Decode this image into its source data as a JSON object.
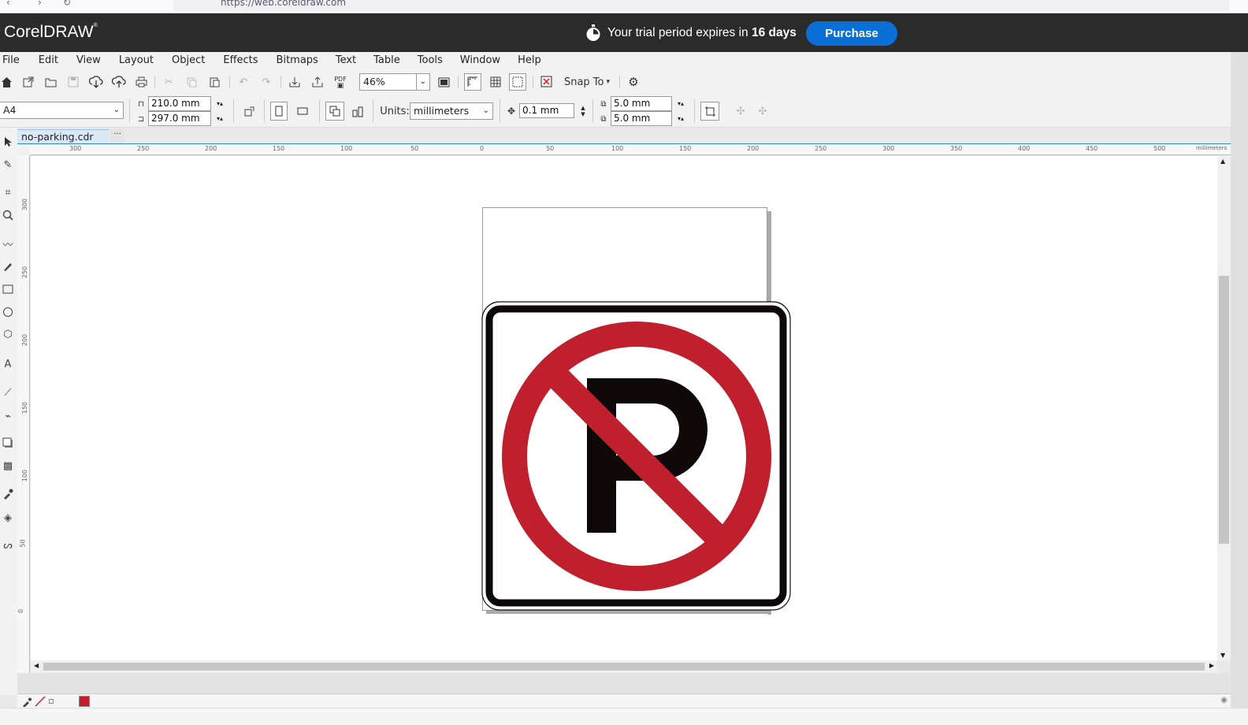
{
  "browser": {
    "url": "https://web.coreldraw.com"
  },
  "app": {
    "name": "CorelDRAW",
    "trademark": "®"
  },
  "trial": {
    "text_prefix": "Your trial period expires in ",
    "days_text": "16 days"
  },
  "purchase_label": "Purchase",
  "menu": [
    "File",
    "Edit",
    "View",
    "Layout",
    "Object",
    "Effects",
    "Bitmaps",
    "Text",
    "Table",
    "Tools",
    "Window",
    "Help"
  ],
  "toolbar": {
    "zoom": "46%",
    "pdf_label": "PDF",
    "snap_to": "Snap To",
    "snap_caret": "▾"
  },
  "property_bar": {
    "page_size": "A4",
    "width": "210.0 mm",
    "height": "297.0 mm",
    "units_label": "Units:",
    "units_value": "millimeters",
    "nudge": "0.1 mm",
    "dup_x": "5.0 mm",
    "dup_y": "5.0 mm"
  },
  "document_tab": {
    "name": "no-parking.cdr",
    "more": "···"
  },
  "rulers": {
    "horizontal_ticks": [
      "300",
      "250",
      "200",
      "150",
      "100",
      "50",
      "0",
      "50",
      "100",
      "150",
      "200",
      "250",
      "300",
      "350",
      "400",
      "450",
      "500"
    ],
    "vertical_ticks": [
      "300",
      "250",
      "200",
      "150",
      "100",
      "50",
      "0"
    ],
    "unit_label": "millimeters"
  },
  "colors": {
    "accent": "#0a6fd6",
    "sign_red": "#c0202e",
    "sign_black": "#0e0809",
    "titlebar": "#2b2b2b"
  },
  "sign": {
    "letter": "P"
  }
}
